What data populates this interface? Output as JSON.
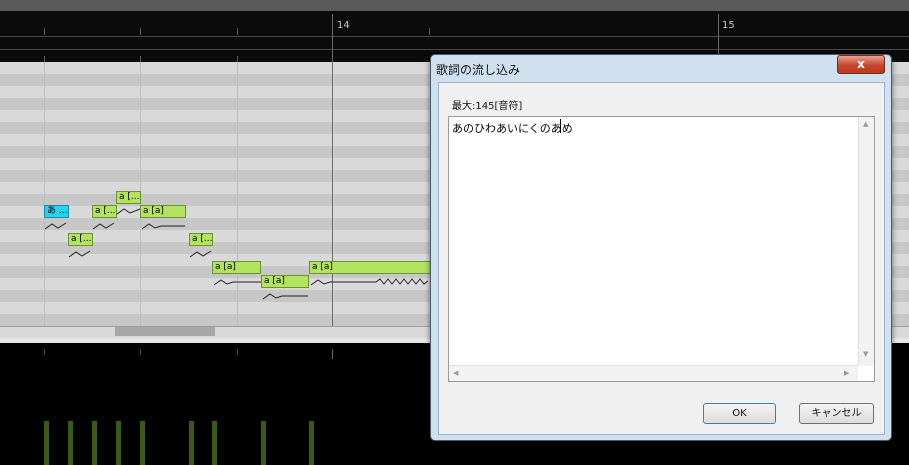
{
  "ruler": {
    "measures": [
      "14",
      "15"
    ]
  },
  "notes": [
    {
      "label": "あ ..."
    },
    {
      "label": "a [..."
    },
    {
      "label": "a [..."
    },
    {
      "label": "a [a]"
    },
    {
      "label": "a [..."
    },
    {
      "label": "a [..."
    },
    {
      "label": "a [a]"
    },
    {
      "label": "a [a]"
    },
    {
      "label": "a [a]"
    }
  ],
  "dialog": {
    "title": "歌詞の流し込み",
    "close_label": "x",
    "max_label": "最大:145[音符]",
    "lyrics_value": "あのひわあいにくのあめ",
    "ok_label": "OK",
    "cancel_label": "キャンセル"
  },
  "colors": {
    "note": "#b4e35f",
    "selected_note": "#25d3ef",
    "dialog_frame": "#cfe0f0",
    "close_button": "#c7452b"
  }
}
